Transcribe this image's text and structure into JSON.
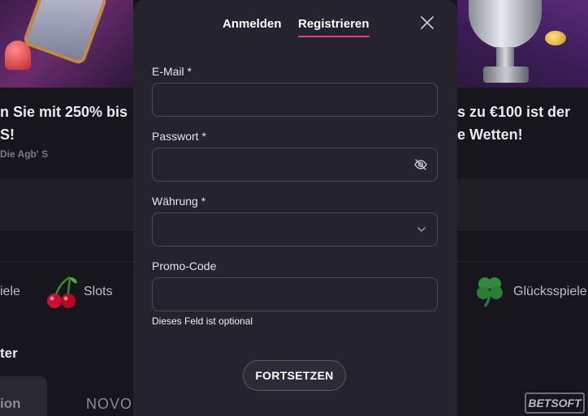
{
  "modal": {
    "tabs": [
      {
        "label": "Anmelden",
        "active": false
      },
      {
        "label": "Registrieren",
        "active": true
      }
    ],
    "fields": {
      "email": {
        "label": "E-Mail *",
        "value": "",
        "placeholder": ""
      },
      "password": {
        "label": "Passwort *",
        "value": "",
        "placeholder": "",
        "icon": "eye-off-icon"
      },
      "currency": {
        "label": "Währung *",
        "value": "",
        "icon": "chevron-down-icon"
      },
      "promo": {
        "label": "Promo-Code",
        "value": "",
        "placeholder": "",
        "helper": "Dieses Feld ist optional"
      }
    },
    "submit_label": "FORTSETZEN",
    "accent_color": "#e63a8c"
  },
  "background": {
    "promo_left_line1": "n Sie mit 250% bis",
    "promo_left_line2": "S!",
    "promo_left_small": "Die Agb' S",
    "promo_right_line1": "s zu €100 ist der",
    "promo_right_line2": "e Wetten!",
    "categories": [
      {
        "label": "iele"
      },
      {
        "label": "Slots",
        "icon": "cherry-icon"
      },
      {
        "label": "Glücksspiele",
        "icon": "clover-icon"
      }
    ],
    "section_title": "ter",
    "tile_text": "ion",
    "providers": [
      "NOVOM",
      "BETSOFT"
    ]
  }
}
